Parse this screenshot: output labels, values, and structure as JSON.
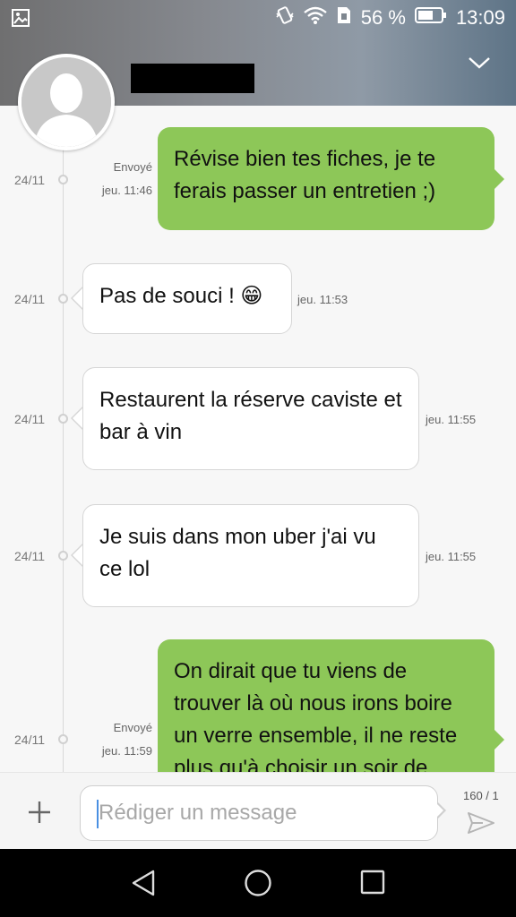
{
  "status_bar": {
    "battery_percent": "56 %",
    "time": "13:09",
    "icons": [
      "image-icon",
      "vibrate-icon",
      "wifi-icon",
      "sim-icon",
      "battery-icon"
    ]
  },
  "header": {
    "contact_name": "",
    "expand_icon": "chevron-down-icon"
  },
  "messages": [
    {
      "direction": "out",
      "date": "24/11",
      "status": "Envoyé",
      "time": "jeu. 11:46",
      "text": "Révise bien tes fiches, je te ferais passer un entretien ;)"
    },
    {
      "direction": "in",
      "date": "24/11",
      "time": "jeu. 11:53",
      "text": "Pas de souci ! 😁"
    },
    {
      "direction": "in",
      "date": "24/11",
      "time": "jeu. 11:55",
      "text": "Restaurent la réserve caviste et bar à vin"
    },
    {
      "direction": "in",
      "date": "24/11",
      "time": "jeu. 11:55",
      "text": "Je suis dans mon uber j'ai vu ce lol"
    },
    {
      "direction": "out",
      "date": "24/11",
      "status": "Envoyé",
      "time": "jeu. 11:59",
      "text": "On dirait que tu viens de trouver là où nous irons boire un verre ensemble, il ne reste plus qu'à choisir un soir de"
    }
  ],
  "composer": {
    "placeholder": "Rédiger un message",
    "char_counter": "160 / 1"
  },
  "colors": {
    "outgoing_bubble": "#8dc758",
    "incoming_bubble": "#ffffff"
  }
}
